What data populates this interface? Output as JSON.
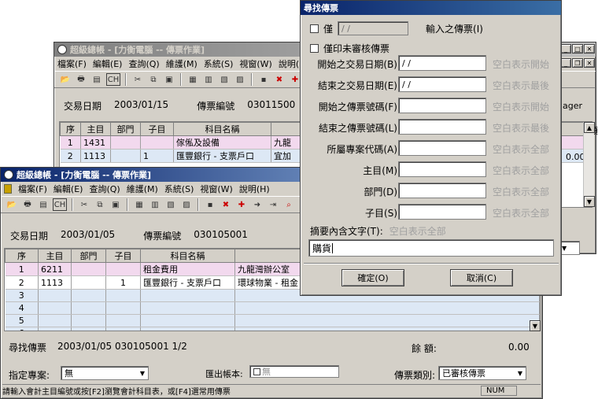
{
  "back_window": {
    "title": "超級總帳 - [力衡電腦 -- 傳票作業]",
    "menus": [
      "檔案(F)",
      "編輯(E)",
      "查詢(Q)",
      "維護(M)",
      "系統(S)",
      "視窗(W)",
      "說明(H)"
    ],
    "toolbar_ch": "CH",
    "date_label": "交易日期",
    "date_value": "2003/01/15",
    "voucher_label": "傳票編號",
    "voucher_value": "03011500",
    "right_overflow_text": "ager",
    "right_col_header": "額",
    "right_value": "0.00",
    "columns": [
      "序",
      "主目",
      "部門",
      "子目",
      "科目名稱",
      ""
    ],
    "rows": [
      {
        "seq": "1",
        "main": "1431",
        "dept": "",
        "sub": "",
        "name": "傢俬及設備",
        "memo": "九龍"
      },
      {
        "seq": "2",
        "main": "1113",
        "dept": "",
        "sub": "1",
        "name": "匯豐銀行 - 支票戶口",
        "memo": "宜加"
      }
    ]
  },
  "front_window": {
    "title": "超級總帳 - [力衡電腦 -- 傳票作業]",
    "menus": [
      "檔案(F)",
      "編輯(E)",
      "查詢(Q)",
      "維護(M)",
      "系統(S)",
      "視窗(W)",
      "說明(H)"
    ],
    "toolbar_ch": "CH",
    "date_label": "交易日期",
    "date_value": "2003/01/05",
    "voucher_label": "傳票編號",
    "voucher_value": "030105001",
    "columns": [
      "序",
      "主目",
      "部門",
      "子目",
      "科目名稱",
      "摘"
    ],
    "rows": [
      {
        "seq": "1",
        "main": "6211",
        "dept": "",
        "sub": "",
        "name": "租金費用",
        "memo": "九龍灣辦公室"
      },
      {
        "seq": "2",
        "main": "1113",
        "dept": "",
        "sub": "1",
        "name": "匯豐銀行 - 支票戶口",
        "memo": "環球物業 - 租金"
      },
      {
        "seq": "3",
        "main": "",
        "dept": "",
        "sub": "",
        "name": "",
        "memo": ""
      },
      {
        "seq": "4",
        "main": "",
        "dept": "",
        "sub": "",
        "name": "",
        "memo": ""
      },
      {
        "seq": "5",
        "main": "",
        "dept": "",
        "sub": "",
        "name": "",
        "memo": ""
      },
      {
        "seq": "6",
        "main": "",
        "dept": "",
        "sub": "",
        "name": "",
        "memo": ""
      }
    ],
    "find_label": "尋找傳票",
    "find_value": "2003/01/05  030105001  1/2",
    "balance_label": "餘 額:",
    "balance_value": "0.00",
    "project_label": "指定專案:",
    "project_value": "無",
    "export_label": "匯出帳本:",
    "export_value": "無",
    "type_label": "傳票類別:",
    "type_value": "已審核傳票",
    "status_text": "請輸入會計主目編號或按[F2]瀏覽會計科目表，或[F4]選常用傳票",
    "status_num": "NUM"
  },
  "dialog": {
    "title": "尋找傳票",
    "only_label": "僅",
    "only_value": "  /  /",
    "only_suffix": "輸入之傳票(I)",
    "unreviewed_label": "僅印未審核傳票",
    "fields": [
      {
        "label": "開始之交易日期(B)",
        "value": "  /  /",
        "hint": "空白表示開始"
      },
      {
        "label": "結束之交易日期(E)",
        "value": "  /  /",
        "hint": "空白表示最後"
      },
      {
        "label": "開始之傳票號碼(F)",
        "value": "",
        "hint": "空白表示開始"
      },
      {
        "label": "結束之傳票號碼(L)",
        "value": "",
        "hint": "空白表示最後"
      },
      {
        "label": "所屬專案代碼(A)",
        "value": "",
        "hint": "空白表示全部"
      },
      {
        "label": "主目(M)",
        "value": "",
        "hint": "空白表示全部"
      },
      {
        "label": "部門(D)",
        "value": "",
        "hint": "空白表示全部"
      },
      {
        "label": "子目(S)",
        "value": "",
        "hint": "空白表示全部"
      }
    ],
    "summary_label": "摘要內含文字(T):",
    "summary_hint": "空白表示全部",
    "summary_value": "購貨",
    "ok_label": "確定(O)",
    "cancel_label": "取消(C)"
  }
}
